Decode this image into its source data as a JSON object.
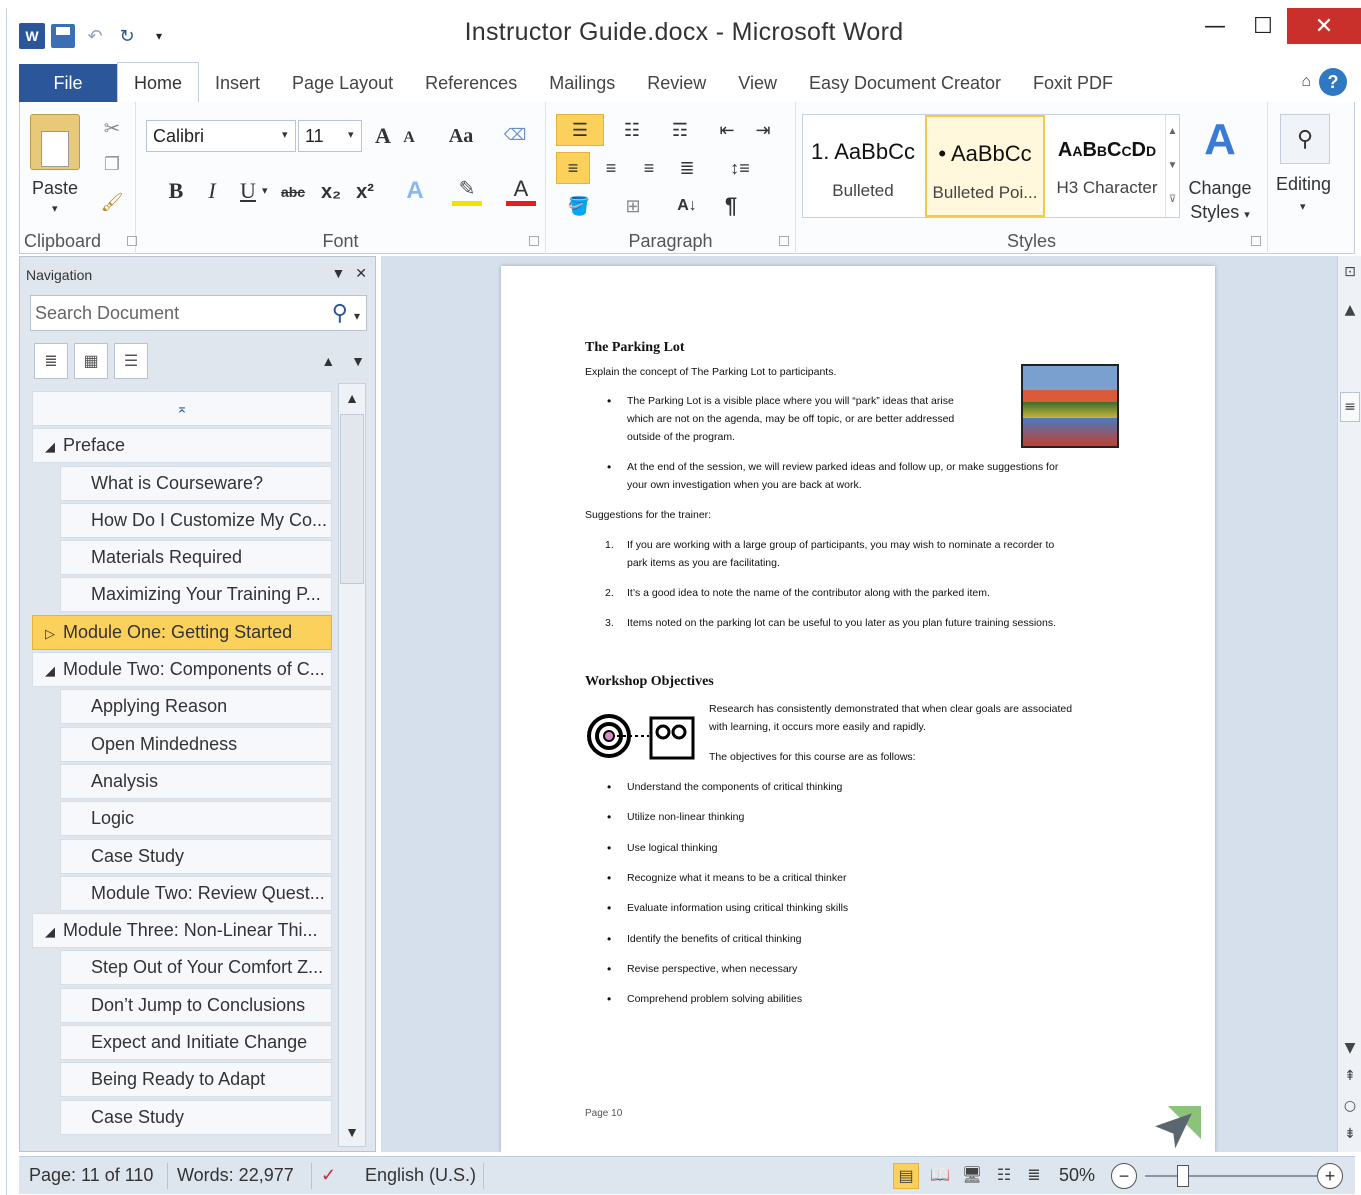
{
  "window": {
    "title": "Instructor Guide.docx - Microsoft Word",
    "app_logo": "W",
    "controls": {
      "minimize": "—",
      "maximize": "☐",
      "close": "✕"
    }
  },
  "tabs": [
    {
      "label": "File"
    },
    {
      "label": "Home"
    },
    {
      "label": "Insert"
    },
    {
      "label": "Page Layout"
    },
    {
      "label": "References"
    },
    {
      "label": "Mailings"
    },
    {
      "label": "Review"
    },
    {
      "label": "View"
    },
    {
      "label": "Easy Document Creator"
    },
    {
      "label": "Foxit PDF"
    }
  ],
  "ribbon": {
    "clipboard": {
      "label": "Clipboard",
      "paste": "Paste"
    },
    "font": {
      "label": "Font",
      "name": "Calibri",
      "size": "11",
      "bold": "B",
      "italic": "I",
      "underline": "U",
      "strike": "abc",
      "subscript": "x₂",
      "superscript": "x²",
      "grow": "A",
      "shrink": "A",
      "case": "Aa",
      "color_letter": "A"
    },
    "paragraph": {
      "label": "Paragraph",
      "pilcrow": "¶"
    },
    "styles": {
      "label": "Styles",
      "items": [
        {
          "sample": "1. AaBbCc",
          "name": "Bulleted"
        },
        {
          "sample": "• AaBbCc",
          "name": "Bulleted Poi..."
        },
        {
          "sample": "AaBbCcDd",
          "name": "H3 Character"
        }
      ],
      "change_styles_1": "Change",
      "change_styles_2": "Styles"
    },
    "editing": {
      "label": "Editing"
    }
  },
  "navigation": {
    "title": "Navigation",
    "search_placeholder": "Search Document",
    "items": [
      {
        "label": "",
        "level": 0
      },
      {
        "label": "Preface",
        "level": 1
      },
      {
        "label": "What is Courseware?",
        "level": 2
      },
      {
        "label": "How Do I Customize My Co...",
        "level": 2
      },
      {
        "label": "Materials Required",
        "level": 2
      },
      {
        "label": "Maximizing Your Training P...",
        "level": 2
      },
      {
        "label": "Module One: Getting Started",
        "level": 1,
        "selected": true
      },
      {
        "label": "Module Two: Components of C...",
        "level": 1
      },
      {
        "label": "Applying Reason",
        "level": 2
      },
      {
        "label": "Open Mindedness",
        "level": 2
      },
      {
        "label": "Analysis",
        "level": 2
      },
      {
        "label": "Logic",
        "level": 2
      },
      {
        "label": "Case Study",
        "level": 2
      },
      {
        "label": "Module Two: Review Quest...",
        "level": 2
      },
      {
        "label": "Module Three: Non-Linear Thi...",
        "level": 1
      },
      {
        "label": "Step Out of Your Comfort Z...",
        "level": 2
      },
      {
        "label": "Don’t Jump to Conclusions",
        "level": 2
      },
      {
        "label": "Expect and Initiate Change",
        "level": 2
      },
      {
        "label": "Being Ready to Adapt",
        "level": 2
      },
      {
        "label": "Case Study",
        "level": 2
      }
    ]
  },
  "document": {
    "h1": "The Parking Lot",
    "intro": "Explain the concept of The Parking Lot to participants.",
    "bullet1a": "The Parking Lot is a visible place where you will “park” ideas that arise",
    "bullet1b": "which are not on the agenda, may be off topic, or are better addressed",
    "bullet1c": "outside of the program.",
    "bullet2a": "At the end of the session, we will review parked ideas and follow up, or make suggestions for",
    "bullet2b": "your own investigation when you are back at work.",
    "suggestions": "Suggestions for the trainer:",
    "n1a": "If you are working with a large group of participants, you may wish to nominate a recorder to",
    "n1b": "park items as you are facilitating.",
    "n2": "It’s a good idea to note the name of the contributor along with the parked item.",
    "n3": "Items noted on the parking lot can be useful to you later as you plan future training sessions.",
    "h2": "Workshop Objectives",
    "obj_intro_a": "Research has consistently demonstrated that when clear goals are associated",
    "obj_intro_b": "with learning, it occurs more easily and rapidly.",
    "obj_list_intro": "The objectives for this course are as follows:",
    "objectives": [
      "Understand the components of critical thinking",
      "Utilize non-linear thinking",
      "Use logical thinking",
      "Recognize what it means to be a critical thinker",
      "Evaluate information using critical thinking skills",
      "Identify the benefits of critical thinking",
      "Revise perspective, when necessary",
      "Comprehend problem solving abilities"
    ],
    "footer": "Page 10"
  },
  "status": {
    "page": "Page: 11 of 110",
    "words": "Words: 22,977",
    "language": "English (U.S.)",
    "zoom": "50%"
  }
}
